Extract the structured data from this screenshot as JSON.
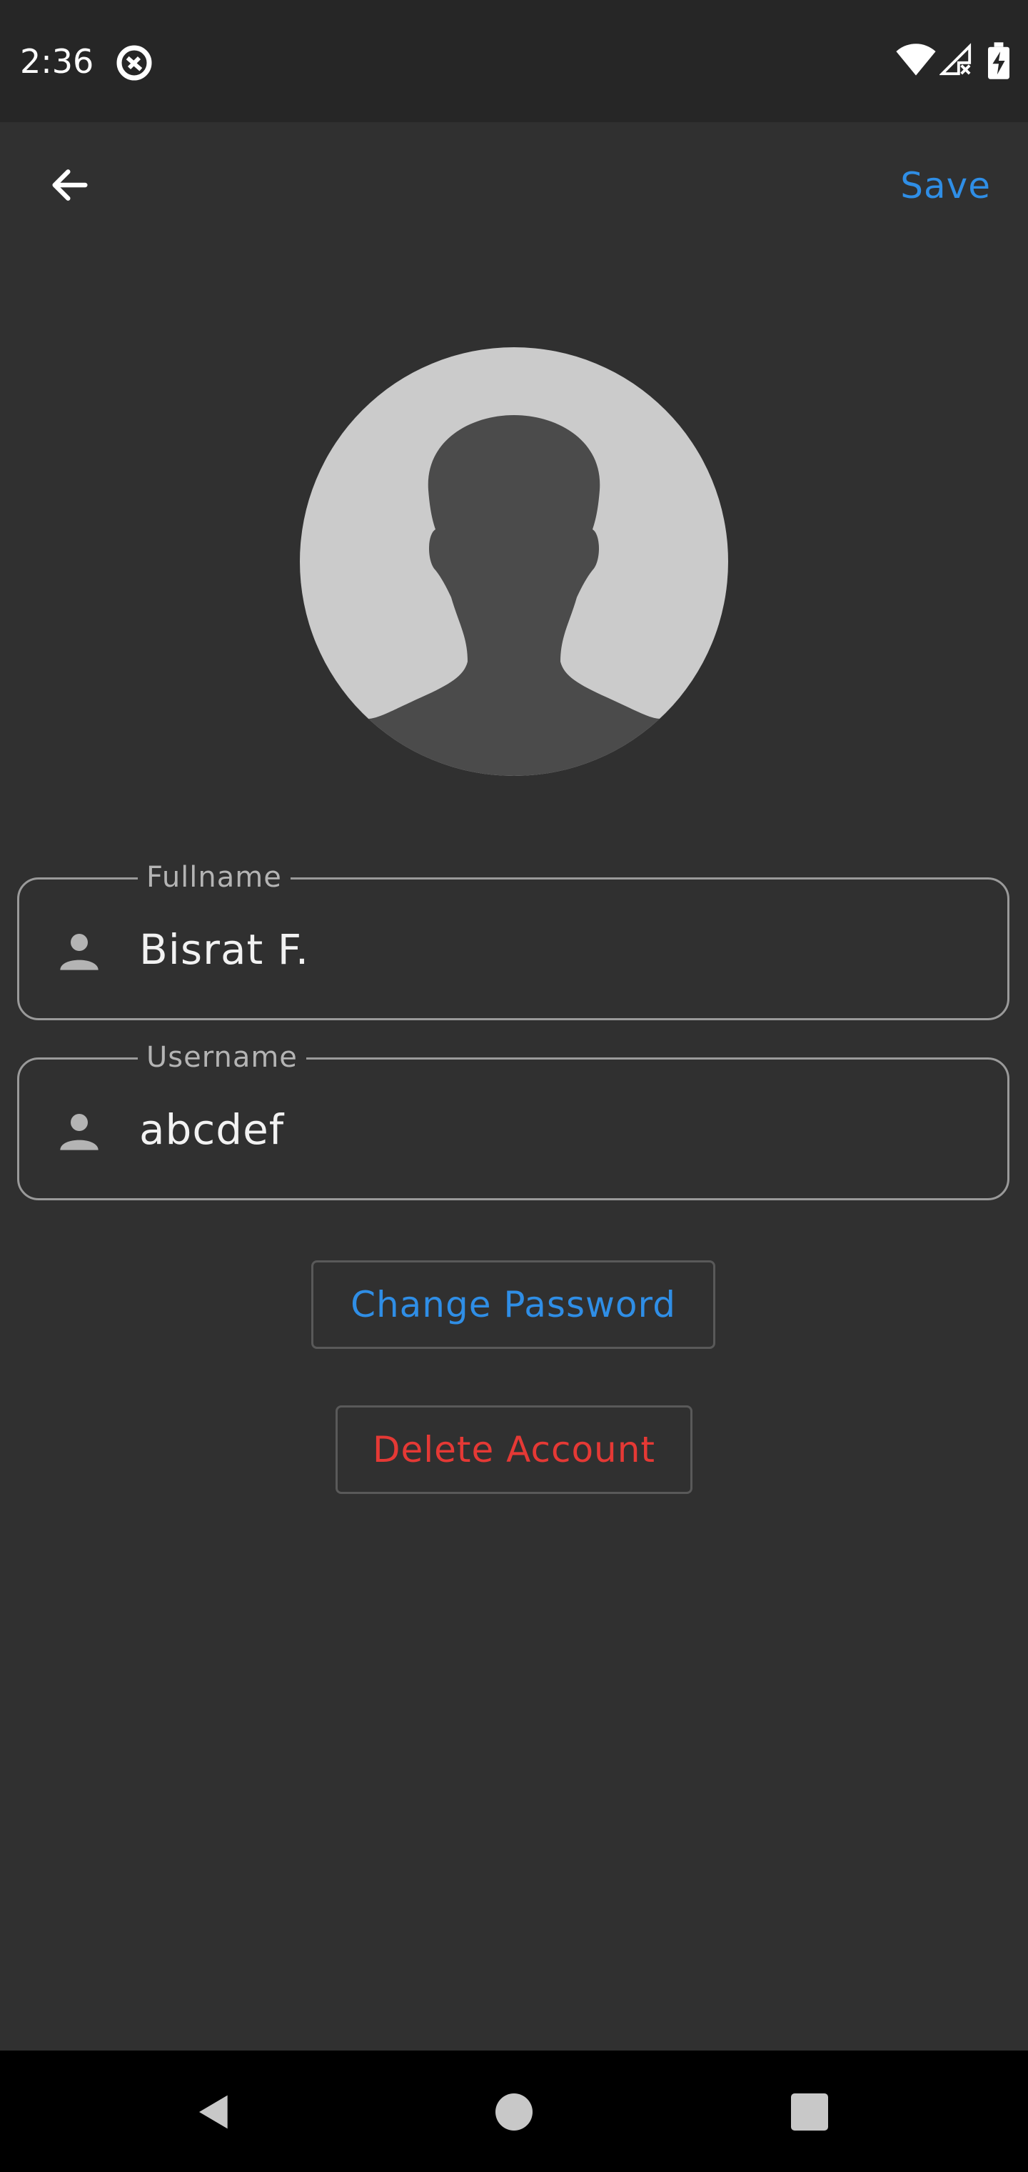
{
  "status_bar": {
    "time": "2:36",
    "icons": [
      "app-notification-icon",
      "wifi-icon",
      "cellular-signal-no-data-icon",
      "battery-charging-icon"
    ]
  },
  "app_bar": {
    "back_icon": "arrow-back-icon",
    "save_label": "Save"
  },
  "avatar": {
    "icon": "default-user-silhouette"
  },
  "form": {
    "fullname": {
      "label": "Fullname",
      "value": "Bisrat F.",
      "icon": "person-icon"
    },
    "username": {
      "label": "Username",
      "value": "abcdef",
      "icon": "person-icon"
    }
  },
  "actions": {
    "change_password_label": "Change Password",
    "delete_account_label": "Delete Account"
  },
  "nav_bar": {
    "icons": [
      "nav-back-icon",
      "nav-home-icon",
      "nav-recents-icon"
    ]
  },
  "colors": {
    "background": "#303030",
    "status_bar": "#262626",
    "accent": "#2f8ee6",
    "danger": "#e53935",
    "field_border": "#9a9a9a"
  }
}
